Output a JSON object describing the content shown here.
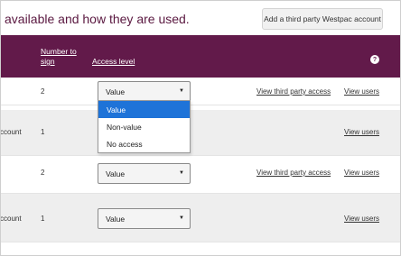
{
  "intro_text": "available and how they are used.",
  "add_button_label": "Add a third party Westpac account",
  "table_header": {
    "number_to_sign": "Number to sign",
    "access_level": "Access level",
    "help": "?"
  },
  "rows": [
    {
      "name": "",
      "number": "2",
      "access": "Value",
      "third_party_link": "View third party access",
      "users_link": "View users"
    },
    {
      "name": "ccount",
      "number": "1",
      "access": "",
      "third_party_link": "",
      "users_link": "View users"
    },
    {
      "name": "",
      "number": "2",
      "access": "Value",
      "third_party_link": "View third party access",
      "users_link": "View users"
    },
    {
      "name": "ccount",
      "number": "1",
      "access": "Value",
      "third_party_link": "",
      "users_link": "View users"
    }
  ],
  "dropdown": {
    "options": [
      "Value",
      "Non-value",
      "No access"
    ],
    "selected": "Value"
  },
  "colors": {
    "header_bg": "#621a4a",
    "intro_text": "#5a1840",
    "dropdown_highlight": "#1e73d8"
  }
}
